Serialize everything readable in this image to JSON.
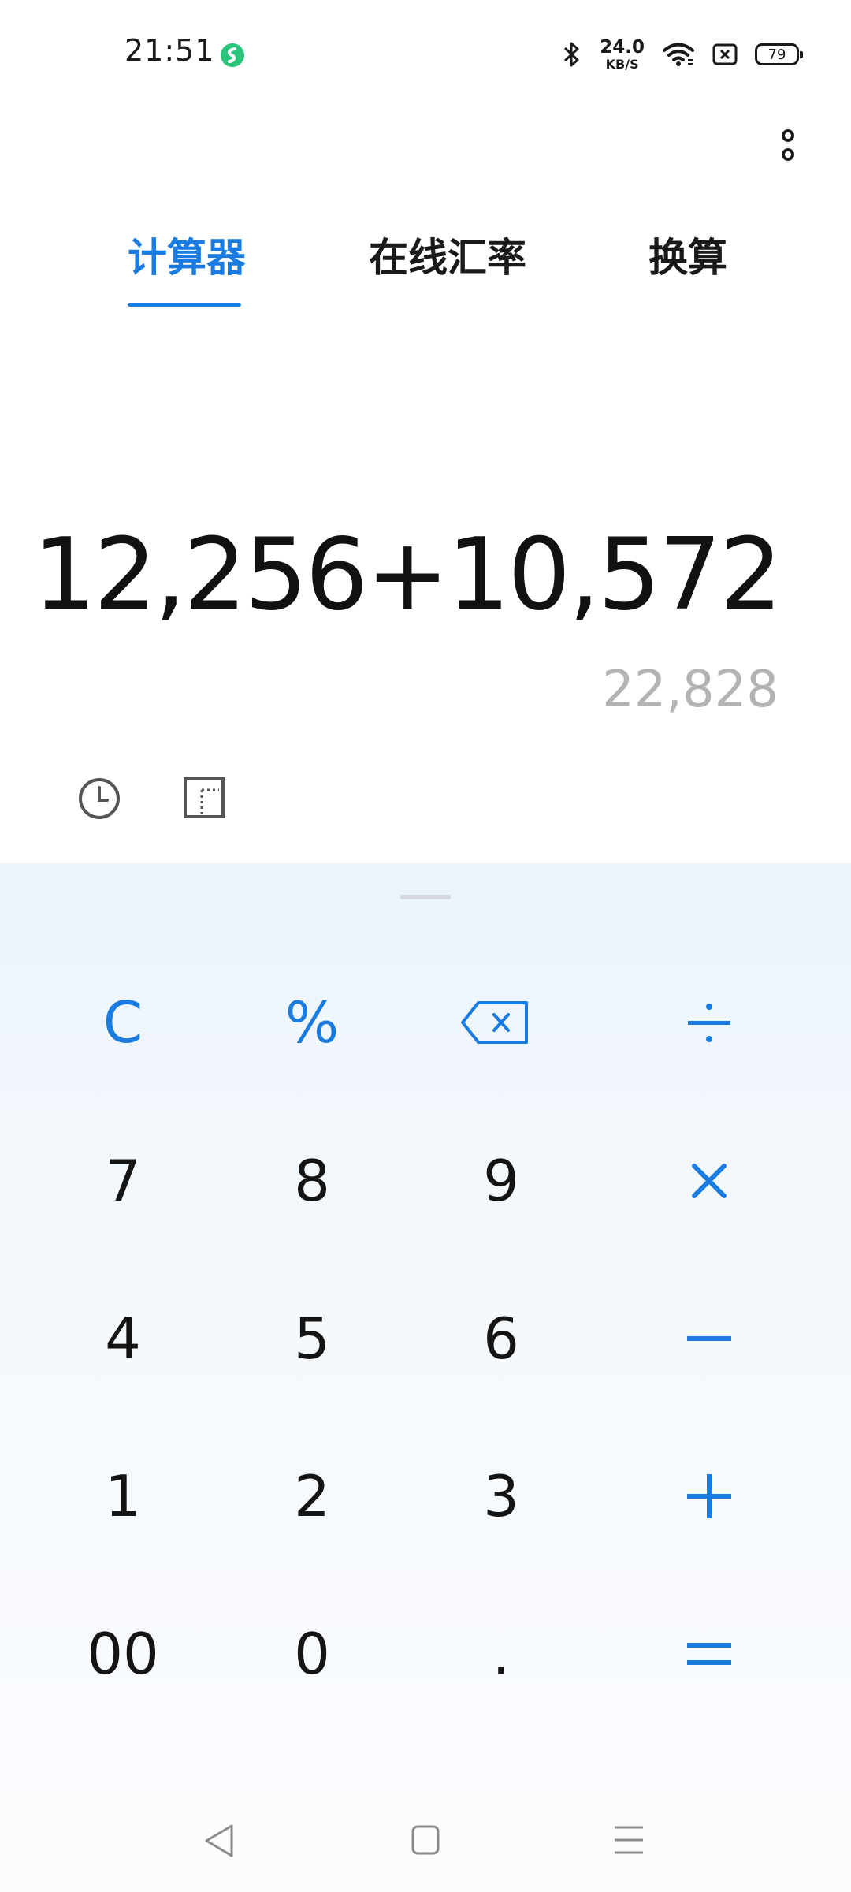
{
  "status_bar": {
    "time": "21:51",
    "net_speed_value": "24.0",
    "net_speed_unit": "KB/S",
    "battery": "79",
    "icons": [
      "app-notification-icon",
      "bluetooth-icon",
      "wifi-icon",
      "sim-icon",
      "battery-icon"
    ]
  },
  "tabs": [
    {
      "label": "计算器",
      "active": true
    },
    {
      "label": "在线汇率",
      "active": false
    },
    {
      "label": "换算",
      "active": false
    }
  ],
  "display": {
    "expression": "12,256+10,572",
    "result": "22,828"
  },
  "tools": {
    "history_icon": "clock-icon",
    "mode_icon": "scientific-mode-icon"
  },
  "keypad": {
    "rows": [
      [
        "C",
        "%",
        "⌫",
        "÷"
      ],
      [
        "7",
        "8",
        "9",
        "×"
      ],
      [
        "4",
        "5",
        "6",
        "−"
      ],
      [
        "1",
        "2",
        "3",
        "+"
      ],
      [
        "00",
        "0",
        ".",
        "="
      ]
    ],
    "labels": {
      "clear": "C",
      "percent": "%",
      "seven": "7",
      "eight": "8",
      "nine": "9",
      "four": "4",
      "five": "5",
      "six": "6",
      "one": "1",
      "two": "2",
      "three": "3",
      "double_zero": "00",
      "zero": "0",
      "decimal": "."
    },
    "accent_color": "#1a7ce0"
  },
  "colors": {
    "accent": "#1a7ce0",
    "result_gray": "#b3b3b3",
    "keypad_bg": "#ebf3fb"
  }
}
